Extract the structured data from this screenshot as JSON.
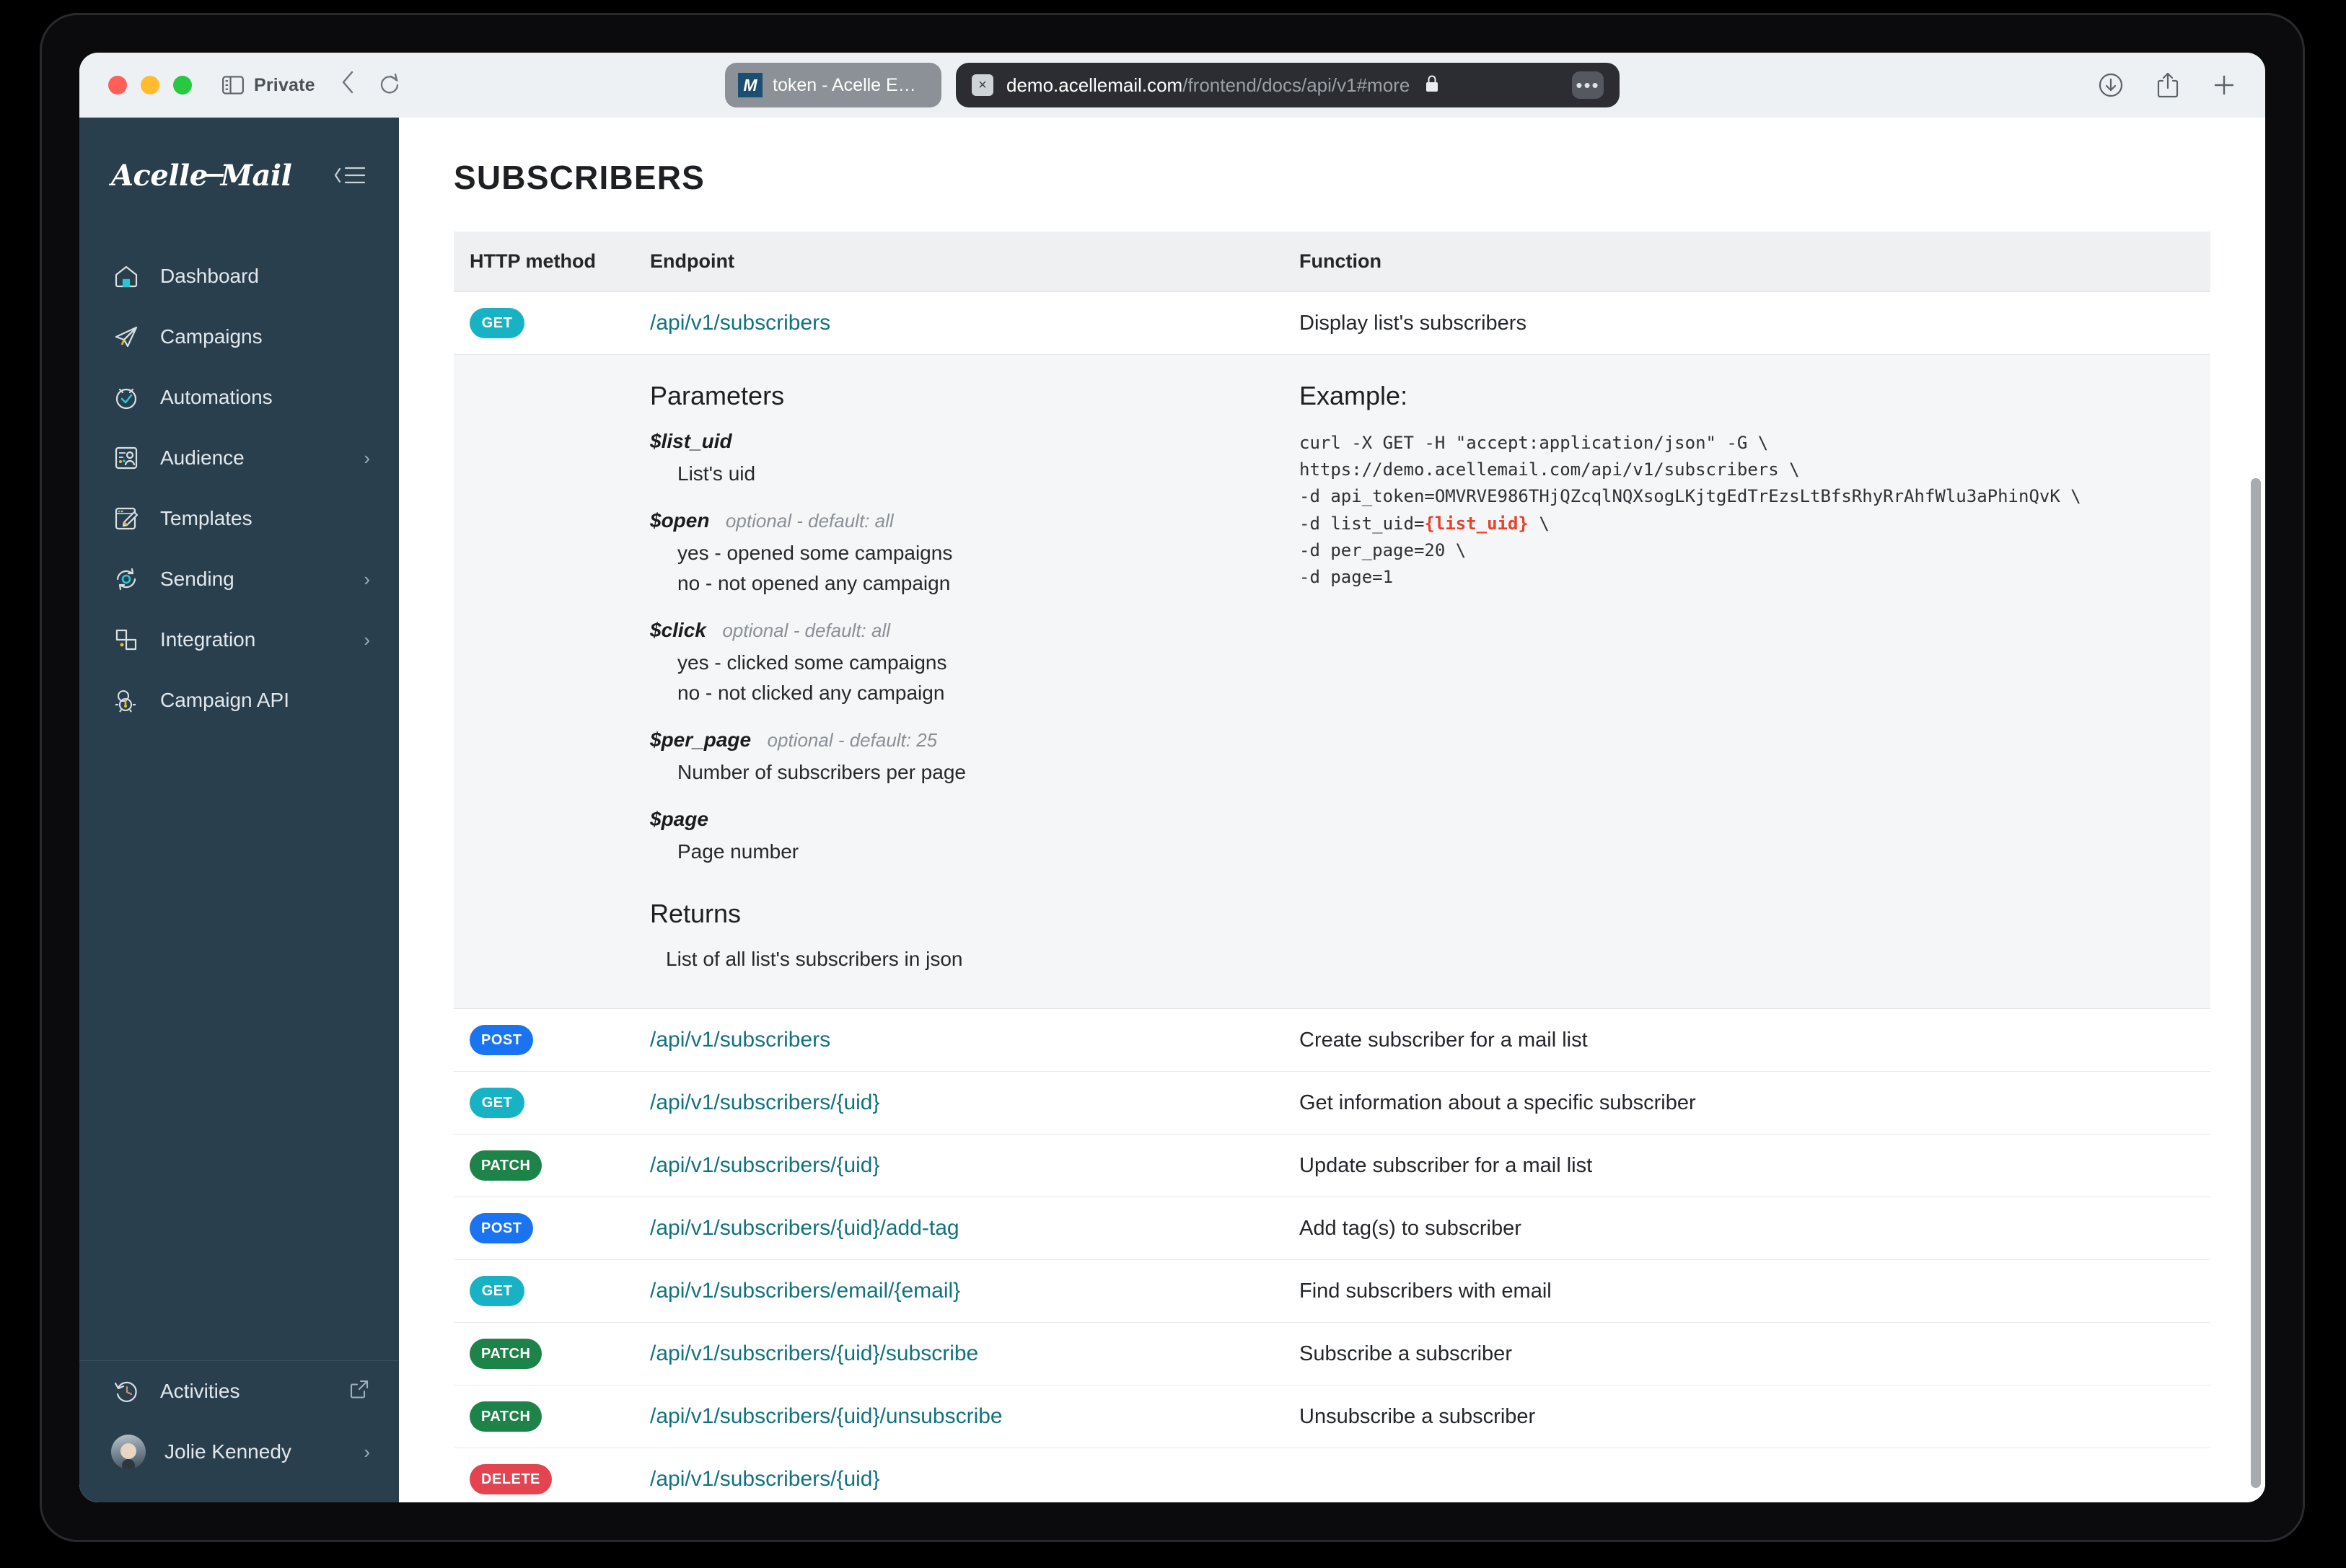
{
  "browser": {
    "private_label": "Private",
    "back_icon": "chevron-left-icon",
    "reload_icon": "reload-icon",
    "sidebar_icon": "sidebar-toggle-icon",
    "tab": {
      "favicon_letter": "M",
      "title": "token - Acelle Em..."
    },
    "url": {
      "host": "demo.acellemail.com",
      "path": "/frontend/docs/api/v1#more",
      "close_glyph": "×",
      "lock_glyph": "🔒",
      "more_glyph": "•••"
    },
    "right_icons": [
      "download-icon",
      "share-icon",
      "new-tab-icon"
    ]
  },
  "sidebar": {
    "brand": {
      "part1": "Acelle",
      "part2": "Mail"
    },
    "collapse_icon": "collapse-sidebar-icon",
    "items": [
      {
        "label": "Dashboard",
        "icon": "home-icon",
        "chevron": ""
      },
      {
        "label": "Campaigns",
        "icon": "paper-plane-icon",
        "chevron": ""
      },
      {
        "label": "Automations",
        "icon": "clock-check-icon",
        "chevron": ""
      },
      {
        "label": "Audience",
        "icon": "audience-icon",
        "chevron": "›"
      },
      {
        "label": "Templates",
        "icon": "template-brush-icon",
        "chevron": ""
      },
      {
        "label": "Sending",
        "icon": "sending-gear-icon",
        "chevron": "›"
      },
      {
        "label": "Integration",
        "icon": "integration-icon",
        "chevron": "›"
      },
      {
        "label": "Campaign API",
        "icon": "api-gear-icon",
        "chevron": ""
      }
    ],
    "footer": [
      {
        "label": "Activities",
        "icon": "history-clock-icon",
        "chevron": "external-link-icon"
      },
      {
        "label": "Jolie Kennedy",
        "icon": "avatar",
        "chevron": "›"
      }
    ]
  },
  "main": {
    "title": "SUBSCRIBERS",
    "table": {
      "headers": [
        "HTTP method",
        "Endpoint",
        "Function"
      ],
      "rows": [
        {
          "method": "GET",
          "endpoint": "/api/v1/subscribers",
          "function": "Display list's subscribers"
        },
        {
          "method": "POST",
          "endpoint": "/api/v1/subscribers",
          "function": "Create subscriber for a mail list"
        },
        {
          "method": "GET",
          "endpoint": "/api/v1/subscribers/{uid}",
          "function": "Get information about a specific subscriber"
        },
        {
          "method": "PATCH",
          "endpoint": "/api/v1/subscribers/{uid}",
          "function": "Update subscriber for a mail list"
        },
        {
          "method": "POST",
          "endpoint": "/api/v1/subscribers/{uid}/add-tag",
          "function": "Add tag(s) to subscriber"
        },
        {
          "method": "GET",
          "endpoint": "/api/v1/subscribers/email/{email}",
          "function": "Find subscribers with email"
        },
        {
          "method": "PATCH",
          "endpoint": "/api/v1/subscribers/{uid}/subscribe",
          "function": "Subscribe a subscriber"
        },
        {
          "method": "PATCH",
          "endpoint": "/api/v1/subscribers/{uid}/unsubscribe",
          "function": "Unsubscribe a subscriber"
        },
        {
          "method": "DELETE",
          "endpoint": "/api/v1/subscribers/{uid}",
          "function": ""
        }
      ]
    },
    "detail": {
      "parameters_heading": "Parameters",
      "returns_heading": "Returns",
      "returns_text": "List of all list's subscribers in json",
      "example_heading": "Example:",
      "parameters": [
        {
          "name": "$list_uid",
          "optional": "",
          "desc": "List's uid"
        },
        {
          "name": "$open",
          "optional": "optional - default: all",
          "desc": "yes - opened some campaigns\nno - not opened any campaign"
        },
        {
          "name": "$click",
          "optional": "optional - default: all",
          "desc": "yes - clicked some campaigns\nno - not clicked any campaign"
        },
        {
          "name": "$per_page",
          "optional": "optional - default: 25",
          "desc": "Number of subscribers per page"
        },
        {
          "name": "$page",
          "optional": "",
          "desc": "Page number"
        }
      ],
      "code_lines": [
        {
          "text": "curl -X GET -H \"accept:application/json\" -G \\"
        },
        {
          "text": "https://demo.acellemail.com/api/v1/subscribers \\"
        },
        {
          "text": "-d api_token=OMVRVE986THjQZcqlNQXsogLKjtgEdTrEzsLtBfsRhyRrAhfWlu3aPhinQvK \\"
        },
        {
          "pre": "-d list_uid=",
          "var": "{list_uid}",
          "post": " \\"
        },
        {
          "text": "-d per_page=20 \\"
        },
        {
          "text": "-d page=1"
        }
      ]
    }
  },
  "colors": {
    "sidebar_bg": "#2a3f4d",
    "accent_teal": "#11727f",
    "get": "#17b3c4",
    "post": "#1a73f0",
    "patch": "#1d8348",
    "delete": "#e3444f",
    "code_var": "#e8412b"
  }
}
